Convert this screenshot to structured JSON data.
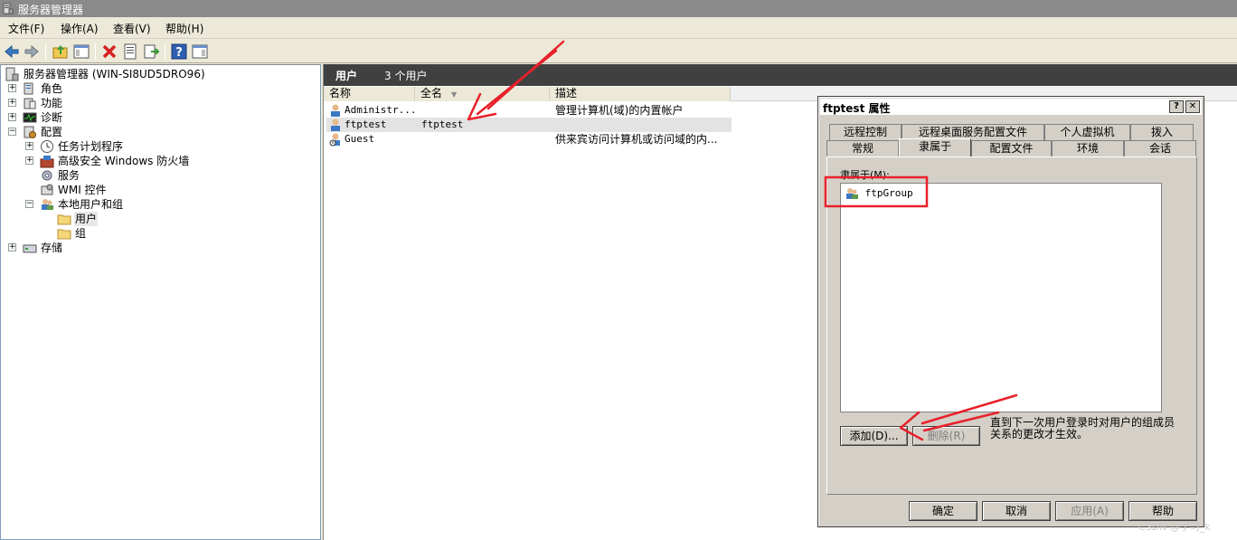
{
  "window": {
    "title": "服务器管理器"
  },
  "menu": [
    "文件(F)",
    "操作(A)",
    "查看(V)",
    "帮助(H)"
  ],
  "toolbar": {
    "icons": [
      "back-arrow-icon",
      "forward-arrow-icon",
      "up-folder-icon",
      "show-hide-tree-icon",
      "delete-icon",
      "properties-icon",
      "export-list-icon",
      "help-icon",
      "show-hide-action-pane-icon"
    ]
  },
  "tree": {
    "root": "服务器管理器 (WIN-SI8UD5DRO96)",
    "roles": "角色",
    "features": "功能",
    "diagnostics": "诊断",
    "configuration": "配置",
    "task_scheduler": "任务计划程序",
    "firewall": "高级安全 Windows 防火墙",
    "services": "服务",
    "wmi": "WMI 控件",
    "local_users_groups": "本地用户和组",
    "users": "用户",
    "groups": "组",
    "storage": "存储"
  },
  "right": {
    "header_title": "用户",
    "header_count": "3 个用户",
    "columns": {
      "name": "名称",
      "fullname": "全名",
      "desc": "描述"
    },
    "rows": [
      {
        "name": "Administr...",
        "fullname": "",
        "desc": "管理计算机(域)的内置帐户"
      },
      {
        "name": "ftptest",
        "fullname": "ftptest",
        "desc": ""
      },
      {
        "name": "Guest",
        "fullname": "",
        "desc": "供来宾访问计算机或访问域的内..."
      }
    ]
  },
  "dialog": {
    "title": "ftptest 属性",
    "help_btn": "?",
    "close_btn": "✕",
    "tabs_row1": [
      "远程控制",
      "远程桌面服务配置文件",
      "个人虚拟机",
      "拨入"
    ],
    "tabs_row2": [
      "常规",
      "隶属于",
      "配置文件",
      "环境",
      "会话"
    ],
    "member_label": "隶属于(M):",
    "members": [
      "ftpGroup"
    ],
    "add_btn": "添加(D)...",
    "remove_btn": "删除(R)",
    "note": "直到下一次用户登录时对用户的组成员关系的更改才生效。",
    "ok": "确定",
    "cancel": "取消",
    "apply": "应用(A)",
    "help": "帮助"
  },
  "watermark": "CSDN @学习_k",
  "colors": {
    "annotation": "#e8212b",
    "header_bar": "#404040",
    "title_bar": "#8a8a8a"
  }
}
